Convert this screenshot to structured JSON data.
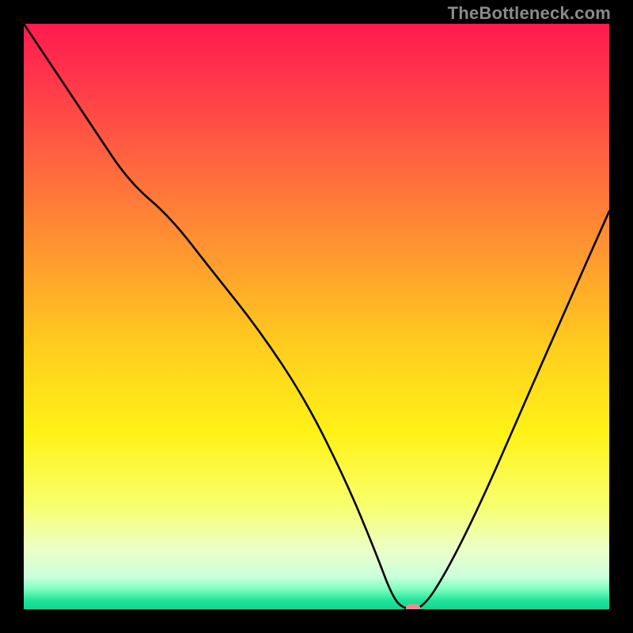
{
  "watermark": "TheBottleneck.com",
  "chart_data": {
    "type": "line",
    "title": "",
    "xlabel": "",
    "ylabel": "",
    "xlim": [
      0,
      100
    ],
    "ylim": [
      0,
      100
    ],
    "grid": false,
    "legend": false,
    "background_gradient_stops": [
      {
        "t": 0.0,
        "color": "#ff1a4f"
      },
      {
        "t": 0.1,
        "color": "#ff384a"
      },
      {
        "t": 0.25,
        "color": "#ff6a3e"
      },
      {
        "t": 0.4,
        "color": "#ff9a2f"
      },
      {
        "t": 0.55,
        "color": "#ffcd1e"
      },
      {
        "t": 0.7,
        "color": "#fff217"
      },
      {
        "t": 0.82,
        "color": "#f8ff6c"
      },
      {
        "t": 0.9,
        "color": "#ecffc9"
      },
      {
        "t": 0.945,
        "color": "#c9ffdb"
      },
      {
        "t": 0.965,
        "color": "#7fffc0"
      },
      {
        "t": 0.985,
        "color": "#20e49b"
      },
      {
        "t": 1.0,
        "color": "#12d492"
      }
    ],
    "series": [
      {
        "name": "bottleneck-curve",
        "x": [
          0,
          6,
          12,
          18,
          25,
          32,
          40,
          48,
          55,
          60,
          63,
          65,
          68,
          72,
          78,
          85,
          92,
          100
        ],
        "y": [
          100,
          91,
          82,
          73,
          67,
          58,
          48,
          36,
          22,
          10,
          2,
          0,
          0,
          6,
          18,
          34,
          50,
          68
        ]
      }
    ],
    "marker": {
      "x": 66.5,
      "y": 0,
      "width_pct": 2.5,
      "height_pct": 1.6,
      "color": "#e3928e"
    }
  }
}
